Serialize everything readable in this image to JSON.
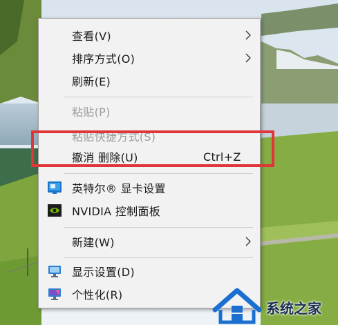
{
  "menu": {
    "items": [
      {
        "label": "查看(V)",
        "has_submenu": true,
        "disabled": false
      },
      {
        "label": "排序方式(O)",
        "has_submenu": true,
        "disabled": false
      },
      {
        "label": "刷新(E)",
        "has_submenu": false,
        "disabled": false
      },
      {
        "label": "粘贴(P)",
        "has_submenu": false,
        "disabled": true
      },
      {
        "label": "粘贴快捷方式(S)",
        "has_submenu": false,
        "disabled": true
      },
      {
        "label": "撤消 删除(U)",
        "shortcut": "Ctrl+Z",
        "has_submenu": false,
        "disabled": false
      },
      {
        "label": "英特尔® 显卡设置",
        "icon": "intel-graphics-icon",
        "has_submenu": false,
        "disabled": false
      },
      {
        "label": "NVIDIA 控制面板",
        "icon": "nvidia-icon",
        "has_submenu": false,
        "disabled": false
      },
      {
        "label": "新建(W)",
        "has_submenu": true,
        "disabled": false
      },
      {
        "label": "显示设置(D)",
        "icon": "display-settings-icon",
        "has_submenu": false,
        "disabled": false
      },
      {
        "label": "个性化(R)",
        "icon": "personalize-icon",
        "has_submenu": false,
        "disabled": false
      }
    ]
  },
  "highlight": {
    "color": "#e0363a",
    "target": "撤消 删除(U)"
  },
  "watermark": {
    "text": "系统之家",
    "icon": "house-logo-icon"
  },
  "colors": {
    "menu_bg": "#f2f2f2",
    "text": "#1a1a1a",
    "disabled_text": "#9c9c9c"
  }
}
